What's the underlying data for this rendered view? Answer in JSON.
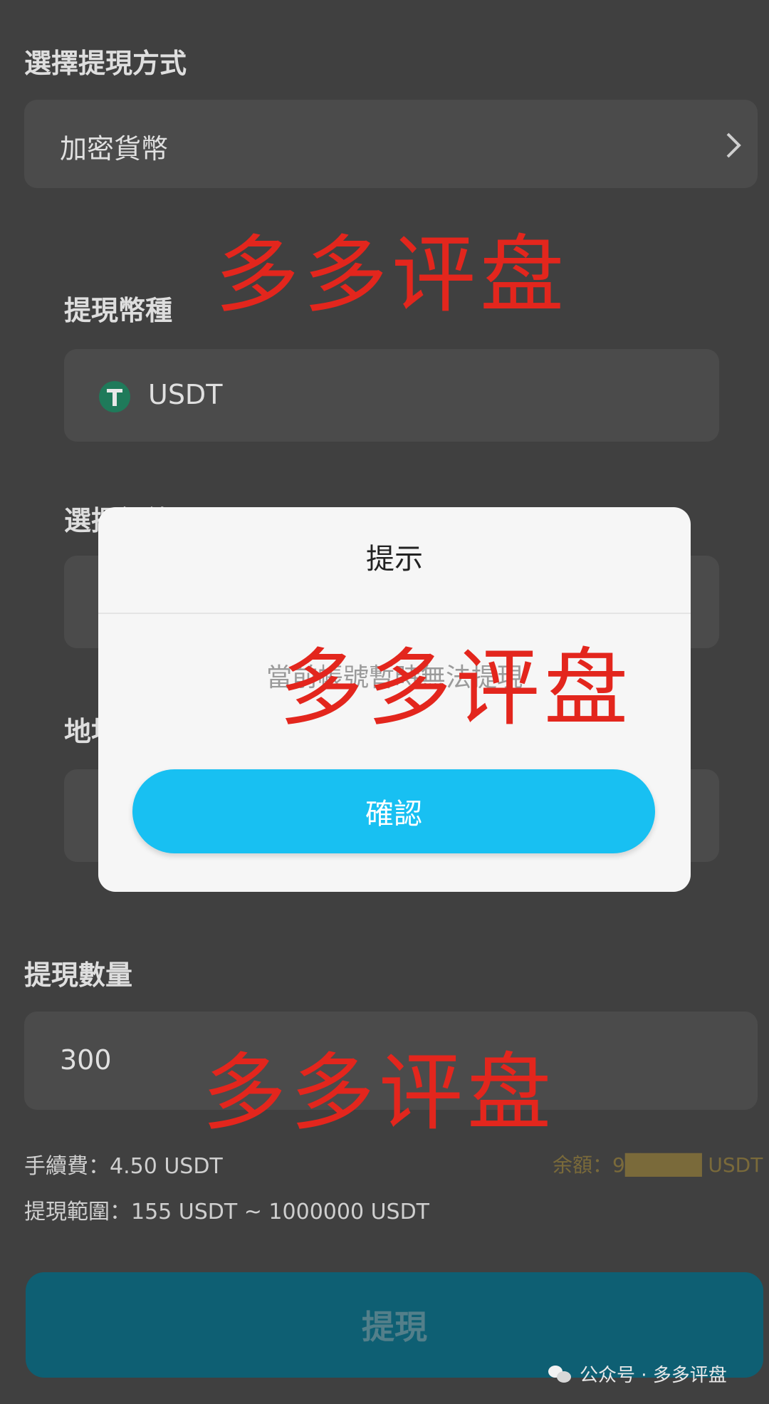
{
  "form": {
    "method_title": "選擇提現方式",
    "method_value": "加密貨幣",
    "currency_title": "提現幣種",
    "currency_value": "USDT",
    "network_title": "選擇網絡",
    "address_title": "地址",
    "amount_title": "提現數量",
    "amount_value": "300",
    "fee_text": "手續費：4.50 USDT",
    "balance_text": "余額：9█████ USDT",
    "range_text": "提現範圍：155 USDT ~ 1000000 USDT",
    "submit_label": "提現"
  },
  "dialog": {
    "title": "提示",
    "message": "當前帳號暫時無法提現",
    "confirm_label": "確認"
  },
  "watermarks": [
    "多多评盘",
    "多多评盘",
    "多多评盘"
  ],
  "footer": {
    "brand": "公众号 · 多多评盘"
  },
  "colors": {
    "accent_button": "#18c0f2",
    "submit_button": "#0e5f73",
    "watermark": "#e3261d",
    "usdt_icon": "#26a17b"
  },
  "icons": {
    "chevron": "chevron-right-icon",
    "currency": "usdt-icon",
    "footer": "wechat-icon"
  }
}
